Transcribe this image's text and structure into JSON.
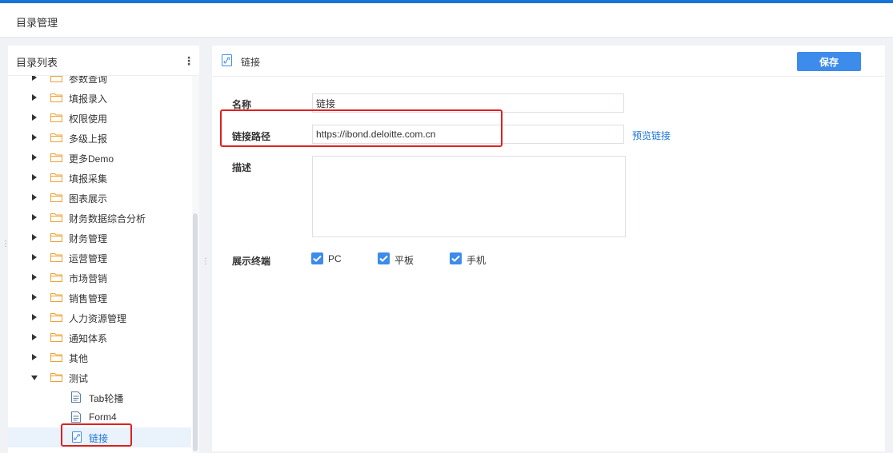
{
  "header": {
    "title": "目录管理"
  },
  "sidebar": {
    "title": "目录列表",
    "more_icon": "more-vertical-icon",
    "items": [
      {
        "label": "参数查询",
        "type": "folder",
        "expanded": false
      },
      {
        "label": "填报录入",
        "type": "folder",
        "expanded": false
      },
      {
        "label": "权限使用",
        "type": "folder",
        "expanded": false
      },
      {
        "label": "多级上报",
        "type": "folder",
        "expanded": false
      },
      {
        "label": "更多Demo",
        "type": "folder",
        "expanded": false
      },
      {
        "label": "填报采集",
        "type": "folder",
        "expanded": false
      },
      {
        "label": "图表展示",
        "type": "folder",
        "expanded": false
      },
      {
        "label": "财务数据综合分析",
        "type": "folder",
        "expanded": false
      },
      {
        "label": "财务管理",
        "type": "folder",
        "expanded": false
      },
      {
        "label": "运营管理",
        "type": "folder",
        "expanded": false
      },
      {
        "label": "市场营销",
        "type": "folder",
        "expanded": false
      },
      {
        "label": "销售管理",
        "type": "folder",
        "expanded": false
      },
      {
        "label": "人力资源管理",
        "type": "folder",
        "expanded": false
      },
      {
        "label": "通知体系",
        "type": "folder",
        "expanded": false
      },
      {
        "label": "其他",
        "type": "folder",
        "expanded": false
      },
      {
        "label": "测试",
        "type": "folder",
        "expanded": true
      },
      {
        "label": "Tab轮播",
        "type": "doc",
        "child": true
      },
      {
        "label": "Form4",
        "type": "doc",
        "child": true
      },
      {
        "label": "链接",
        "type": "link",
        "child": true,
        "selected": true
      }
    ]
  },
  "editor": {
    "title": "链接",
    "save_label": "保存",
    "fields": {
      "name_label": "名称",
      "name_value": "链接",
      "url_label": "链接路径",
      "url_value": "https://ibond.deloitte.com.cn",
      "preview_label": "预览链接",
      "desc_label": "描述",
      "desc_value": "",
      "terminal_label": "展示终端"
    },
    "terminals": [
      {
        "label": "PC",
        "checked": true
      },
      {
        "label": "平板",
        "checked": true
      },
      {
        "label": "手机",
        "checked": true
      }
    ]
  },
  "colors": {
    "accent": "#3d8bea",
    "highlight": "#e02020",
    "folder": "#f0a030"
  }
}
